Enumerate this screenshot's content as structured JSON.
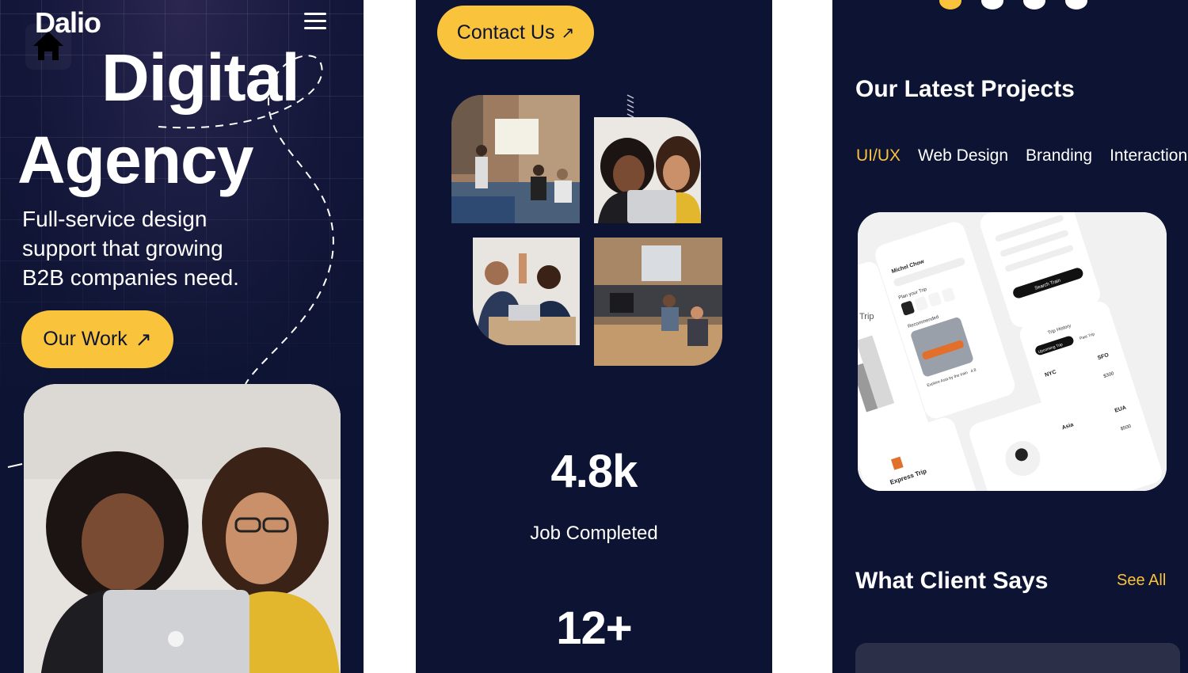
{
  "screen1": {
    "logo": "Dalio",
    "headline_line1": "Digital",
    "headline_line2": "Agency",
    "subtitle": "Full-service design support that growing B2B companies need.",
    "our_work_button": "Our Work",
    "arrow": "↗"
  },
  "screen2": {
    "contact_button": "Contact Us",
    "arrow": "↗",
    "stats": [
      {
        "value": "4.8k",
        "label": "Job Completed"
      },
      {
        "value": "12+",
        "label": ""
      }
    ]
  },
  "screen3": {
    "carousel": {
      "count": 4,
      "active_index": 0
    },
    "projects_title": "Our Latest Projects",
    "tabs": [
      {
        "label": "UI/UX",
        "active": true
      },
      {
        "label": "Web Design",
        "active": false
      },
      {
        "label": "Branding",
        "active": false
      },
      {
        "label": "Interaction",
        "active": false
      }
    ],
    "project_preview": {
      "user_name": "Michel Chow",
      "plan_label": "Plan your Trip",
      "recommended_label": "Recommended",
      "card_caption": "Explore Asia by the train",
      "rating": "4.8",
      "search_button": "Search Train",
      "trip_history": "Trip History",
      "upcoming_trip": "Upcoming Trip",
      "past_trip": "Past Trip",
      "brand": "Express Trip",
      "routes": [
        {
          "from": "NYC",
          "to": "SFO",
          "price": "$300"
        },
        {
          "from": "Asia",
          "to": "EUA",
          "price": "$500"
        }
      ]
    },
    "clients_title": "What Client Says",
    "see_all": "See All"
  },
  "colors": {
    "background": "#0d1433",
    "accent": "#f9c33b",
    "text": "#ffffff",
    "card": "#2b3048"
  }
}
